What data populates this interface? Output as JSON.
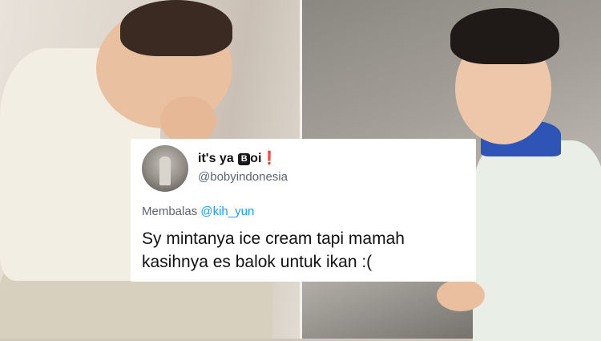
{
  "tweet": {
    "display_name": "it's ya ",
    "display_name_emoji_letter": "B",
    "display_name_suffix": "oi",
    "display_name_mark": "❗",
    "handle": "@bobyindonesia",
    "reply_prefix": "Membalas",
    "reply_to": "@kih_yun",
    "text": "Sy mintanya ice cream tapi mamah kasihnya es balok untuk ikan :("
  },
  "colors": {
    "link": "#1d9bf0",
    "secondary_text": "#5b6570",
    "exclamation": "#e0252d"
  },
  "icons": {
    "avatar": "profile-picture"
  }
}
